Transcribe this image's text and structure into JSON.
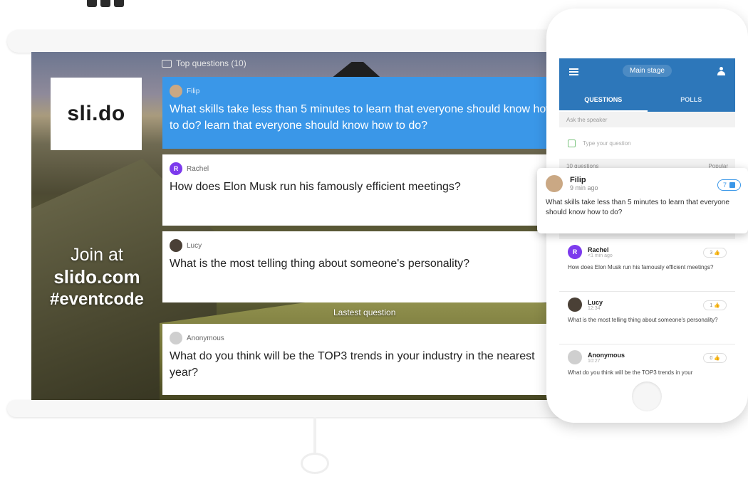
{
  "presenter": {
    "logo_text": "sli.do",
    "top_questions_label": "Top questions (10)",
    "join_line1": "Join at",
    "join_line2": "slido.com",
    "join_line3": "#eventcode",
    "latest_label": "Lastest question",
    "questions": [
      {
        "author": "Filip",
        "text": "What skills take less than 5 minutes to learn that everyone should know how to do? learn that everyone should know how to do?",
        "highlighted": true
      },
      {
        "author": "Rachel",
        "avatar_letter": "R",
        "text": "How does Elon Musk run his famously efficient meetings?"
      },
      {
        "author": "Lucy",
        "text": "What is the most telling thing about someone's personality?"
      }
    ],
    "latest_question": {
      "author": "Anonymous",
      "text": "What do you think will be the TOP3 trends in your industry in the nearest year?"
    }
  },
  "phone": {
    "title": "Main stage",
    "tabs": [
      "QUESTIONS",
      "POLLS"
    ],
    "ask_label": "Ask the speaker",
    "ask_placeholder": "Type your question",
    "count_label": "10 questions",
    "sort_label": "Popular",
    "list": [
      {
        "author": "Rachel",
        "avatar_letter": "R",
        "time": "<1 min ago",
        "likes": "3",
        "text": "How does Elon Musk run his famously efficient meetings?"
      },
      {
        "author": "Lucy",
        "time": "12:34",
        "likes": "1",
        "text": "What is the most telling thing about someone's personality?"
      },
      {
        "author": "Anonymous",
        "time": "10:27",
        "likes": "0",
        "text": "What do you think will be the TOP3 trends in your"
      }
    ]
  },
  "popout": {
    "author": "Filip",
    "time": "9 min ago",
    "likes": "7",
    "text": "What skills take less than 5 minutes to learn that everyone should know how to do?"
  },
  "colors": {
    "accent": "#3a97e8",
    "app_bar": "#2d77ba",
    "rachel_avatar": "#7c3aed"
  }
}
